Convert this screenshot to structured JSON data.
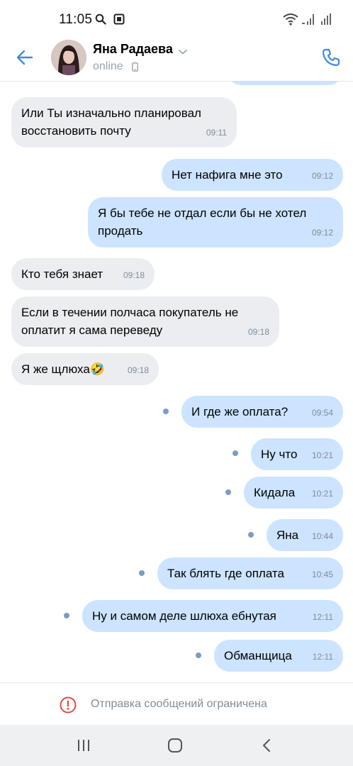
{
  "status_bar": {
    "time": "11:05"
  },
  "header": {
    "contact_name": "Яна Радаева",
    "status": "online"
  },
  "messages": [
    {
      "dir": "in",
      "text": "Или Ты изначально планировал восстановить почту",
      "time": "09:11"
    },
    {
      "dir": "out",
      "text": "Нет нафига  мне это",
      "time": "09:12"
    },
    {
      "dir": "out",
      "text": "Я бы тебе не отдал если бы не хотел продать",
      "time": "09:12"
    },
    {
      "dir": "in",
      "text": "Кто тебя знает",
      "time": "09:18"
    },
    {
      "dir": "in",
      "text": "Если в течении полчаса покупатель не оплатит я сама переведу",
      "time": "09:18"
    },
    {
      "dir": "in",
      "text": "Я же щлюха",
      "emoji": "🤣",
      "time": "09:18"
    },
    {
      "dir": "out",
      "text": "И где же оплата?",
      "time": "09:54",
      "unread": true
    },
    {
      "dir": "out",
      "text": "Ну что",
      "time": "10:21",
      "unread": true
    },
    {
      "dir": "out",
      "text": "Кидала",
      "time": "10:21",
      "unread": true
    },
    {
      "dir": "out",
      "text": "Яна",
      "time": "10:44",
      "unread": true
    },
    {
      "dir": "out",
      "text": "Так блять где оплата",
      "time": "10:45",
      "unread": true
    },
    {
      "dir": "out",
      "text": "Ну и самом деле шлюха ебнутая",
      "time": "12:11",
      "unread": true
    },
    {
      "dir": "out",
      "text": "Обманщица",
      "time": "12:11",
      "unread": true
    }
  ],
  "restricted_notice": "Отправка сообщений ограничена",
  "colors": {
    "accent": "#3f8ae0",
    "incoming_bubble": "#ebedf0",
    "outgoing_bubble": "#cce4ff",
    "error": "#e64646",
    "unread_dot": "#7b9cc6"
  },
  "icons": [
    "search-icon",
    "screenshot-icon",
    "wifi-icon",
    "signal-icon",
    "back-arrow-icon",
    "chevron-down-icon",
    "mobile-icon",
    "phone-icon",
    "error-icon",
    "recent-apps-icon",
    "home-icon",
    "nav-back-icon"
  ]
}
